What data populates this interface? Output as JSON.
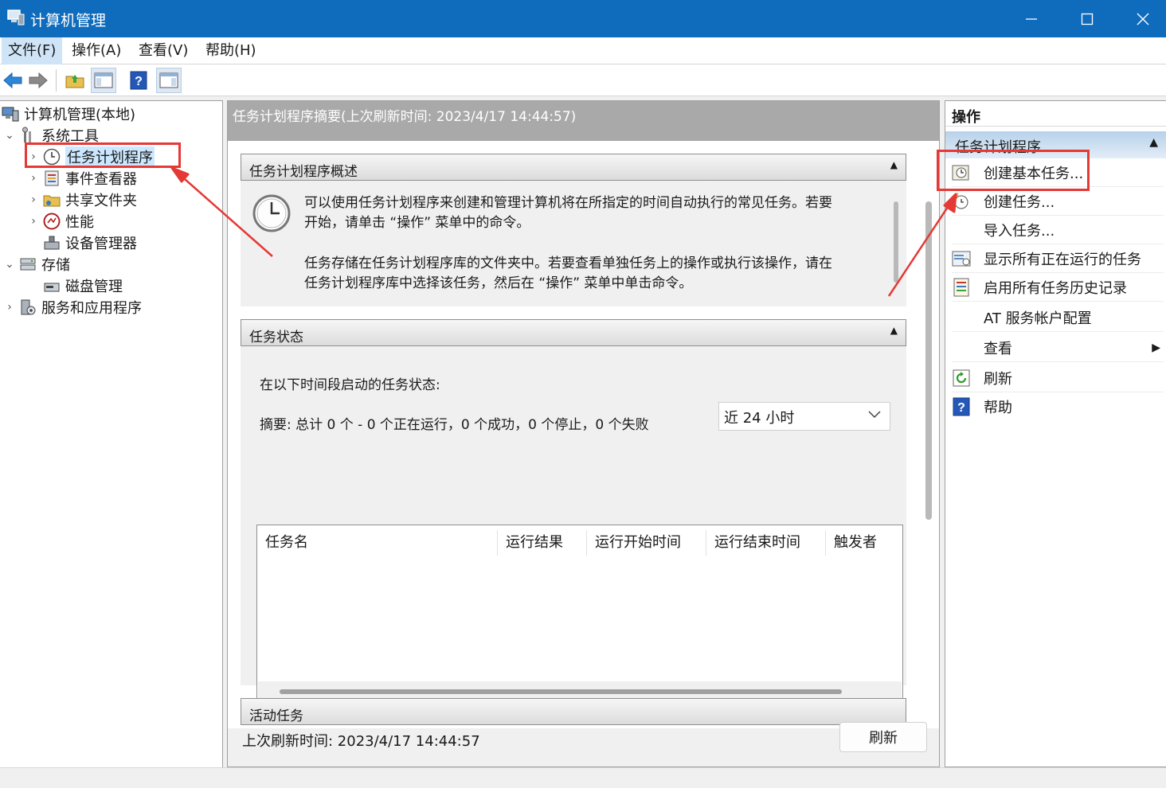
{
  "window": {
    "title": "计算机管理"
  },
  "menu": [
    "文件(F)",
    "操作(A)",
    "查看(V)",
    "帮助(H)"
  ],
  "tree": {
    "root": "计算机管理(本地)",
    "system_tools": "系统工具",
    "task_scheduler": "任务计划程序",
    "event_viewer": "事件查看器",
    "shared_folders": "共享文件夹",
    "performance": "性能",
    "device_manager": "设备管理器",
    "storage": "存储",
    "disk_management": "磁盘管理",
    "services_apps": "服务和应用程序"
  },
  "center": {
    "header": "任务计划程序摘要(上次刷新时间: 2023/4/17 14:44:57)",
    "overview": {
      "title": "任务计划程序概述",
      "line1": "可以使用任务计划程序来创建和管理计算机将在所指定的时间自动执行的常见任务。若要",
      "line2": "开始，请单击 “操作” 菜单中的命令。",
      "line3": "任务存储在任务计划程序库的文件夹中。若要查看单独任务上的操作或执行该操作，请在",
      "line4": "任务计划程序库中选择该任务，然后在 “操作” 菜单中单击命令。"
    },
    "status": {
      "title": "任务状态",
      "period_label": "在以下时间段启动的任务状态:",
      "period_value": "近 24 小时",
      "summary": "摘要: 总计 0 个 - 0 个正在运行，0 个成功，0 个停止，0 个失败",
      "columns": [
        "任务名",
        "运行结果",
        "运行开始时间",
        "运行结束时间",
        "触发者"
      ]
    },
    "next_section_title": "活动任务",
    "last_refresh": "上次刷新时间: 2023/4/17 14:44:57",
    "refresh_button": "刷新"
  },
  "actions": {
    "title": "操作",
    "group": "任务计划程序",
    "items": [
      "创建基本任务...",
      "创建任务...",
      "导入任务...",
      "显示所有正在运行的任务",
      "启用所有任务历史记录",
      "AT 服务帐户配置",
      "查看",
      "刷新",
      "帮助"
    ]
  },
  "colors": {
    "titlebar": "#0f6cbd",
    "annotation": "#e53935",
    "selection": "#cce8ff"
  }
}
